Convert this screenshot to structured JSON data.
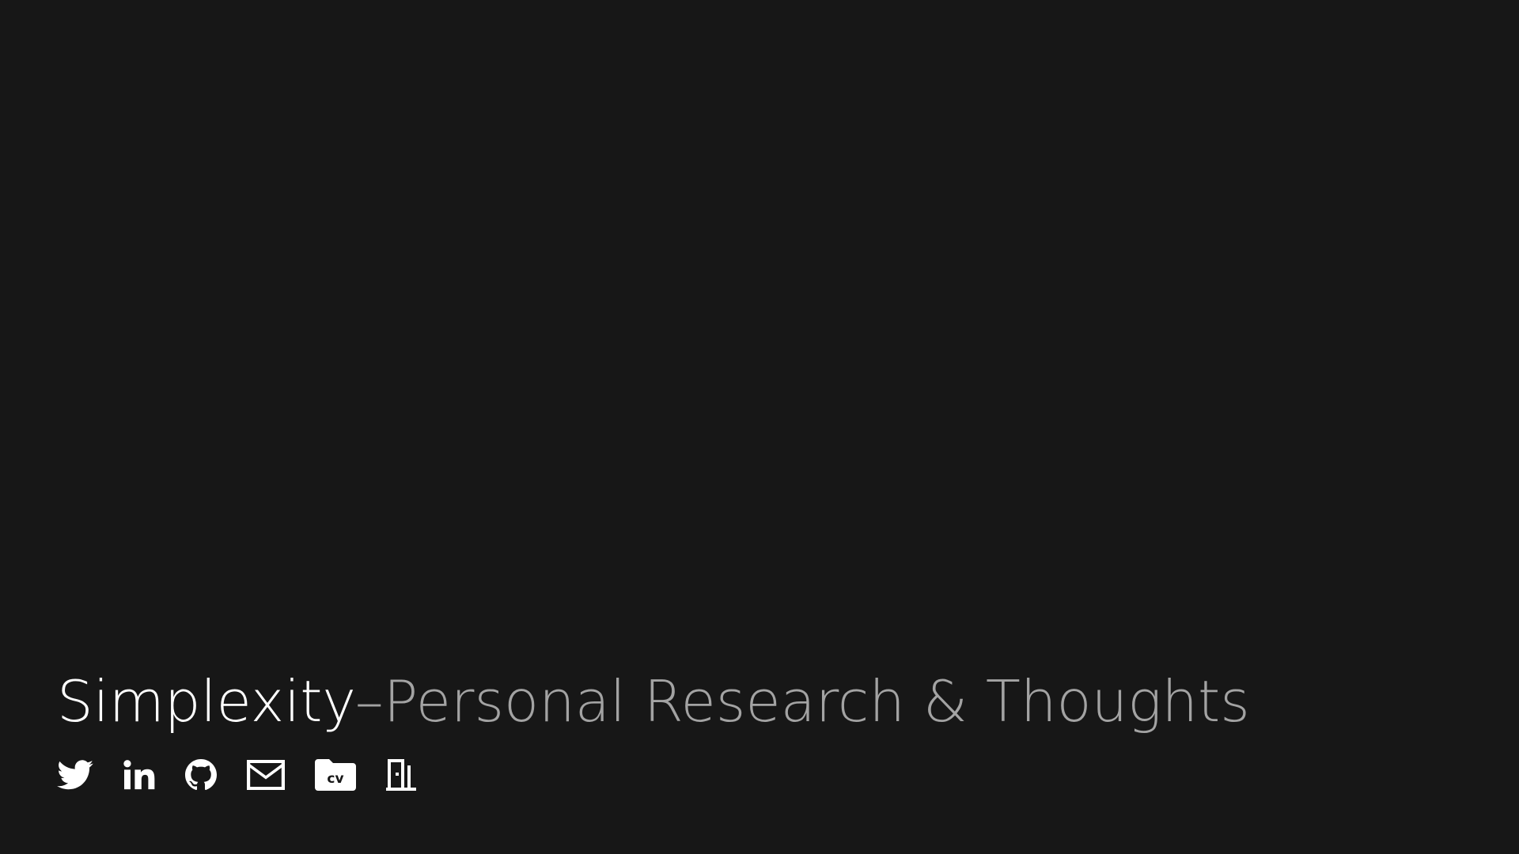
{
  "header": {
    "brand": "Simplexity",
    "separator": "–",
    "tagline": "Personal Research & Thoughts"
  },
  "social_links": [
    {
      "icon": "twitter-icon",
      "label": "Twitter"
    },
    {
      "icon": "linkedin-icon",
      "label": "LinkedIn"
    },
    {
      "icon": "github-icon",
      "label": "GitHub"
    },
    {
      "icon": "mail-icon",
      "label": "Email"
    },
    {
      "icon": "cv-folder-icon",
      "label": "CV",
      "badge_text": "cv"
    },
    {
      "icon": "door-icon",
      "label": "Exit"
    }
  ],
  "colors": {
    "background": "#171717",
    "brand": "#ffffff",
    "tagline": "#a3a3a3",
    "icons": "#ffffff"
  }
}
